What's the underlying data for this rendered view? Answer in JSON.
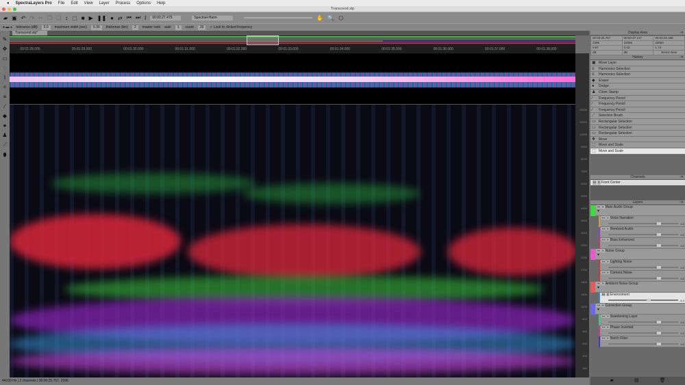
{
  "menubar": {
    "app": "SpectraLayers Pro",
    "items": [
      "File",
      "Edit",
      "View",
      "Layer",
      "Process",
      "Options",
      "Help"
    ]
  },
  "window": {
    "title": "Transcend.slp"
  },
  "options": {
    "tolerance_label": "tolerance (dB)",
    "tolerance": "6.0",
    "max_width_label": "maximum width (sec)",
    "max_width": "0.30",
    "thickness_label": "thickness (bin)",
    "thickness": "2",
    "master_rank_label": "master rank",
    "auto_label": "auto",
    "auto": "1",
    "count_label": "count",
    "count": "20",
    "lock_label": "Lock to clicked frequency"
  },
  "toolbar": {
    "time": "00:00:27.475",
    "mode": "Spectral+Harm"
  },
  "doc_tab": "Transcend.slp*",
  "ruler": [
    "00:01:28.000",
    "00:01:29.000",
    "00:01:30.000",
    "00:01:31.000",
    "00:01:32.000",
    "00:01:33.000",
    "00:01:34.000",
    "00:01:35.000",
    "00:01:36.000",
    "00:01:37.000",
    "00:01:38.000"
  ],
  "freq_axis": [
    "15000",
    "13000",
    "11000",
    "9000",
    "8000",
    "7000",
    "6000",
    "5000",
    "4000",
    "3500",
    "3000",
    "2500",
    "2000",
    "1700",
    "1400",
    "1200",
    "1000",
    "800",
    "600",
    "500",
    "400",
    "300"
  ],
  "status": "44100 Hz | 2 channels | 00:00:25.757, 2396",
  "display_area": {
    "title": "Display Area",
    "cells": [
      "00:00:25.757",
      "00:00:27.137",
      "00:00:28.498",
      "2396",
      "22050",
      "22050",
      "0.87",
      "0.43",
      "1.73",
      "dB",
      "dB",
      ""
    ],
    "reset": "Reset View"
  },
  "history": {
    "title": "History",
    "items": [
      {
        "label": "Move Layer",
        "icon": "move-layer"
      },
      {
        "label": "Harmonics Selection",
        "icon": "harmonics"
      },
      {
        "label": "Harmonics Selection",
        "icon": "harmonics"
      },
      {
        "label": "Eraser",
        "icon": "eraser"
      },
      {
        "label": "Dodge",
        "icon": "dodge"
      },
      {
        "label": "Clone Stamp",
        "icon": "stamp"
      },
      {
        "label": "Frequency Pencil",
        "icon": "pencil"
      },
      {
        "label": "Frequency Pencil",
        "icon": "pencil"
      },
      {
        "label": "Frequency Pencil",
        "icon": "pencil"
      },
      {
        "label": "Selection Brush",
        "icon": "brush"
      },
      {
        "label": "Rectangular Selection",
        "icon": "rect"
      },
      {
        "label": "Rectangular Selection",
        "icon": "rect"
      },
      {
        "label": "Rectangular Selection",
        "icon": "rect"
      },
      {
        "label": "Move",
        "icon": "move"
      },
      {
        "label": "Move and Scale",
        "icon": "scale"
      },
      {
        "label": "Move and Scale",
        "icon": "scale"
      }
    ]
  },
  "channels": {
    "title": "Channels",
    "items": [
      "Front Center"
    ]
  },
  "layers": {
    "title": "Layers",
    "groups": [
      {
        "name": "Main Audio Group",
        "color": "#3ddc3d",
        "layers": [
          {
            "name": "Voice Narration",
            "color": "#c9a23a",
            "value": "0.0"
          },
          {
            "name": "Remixed Audio",
            "color": "#9a3ac9",
            "value": "0.0"
          },
          {
            "name": "Bass Enhanced",
            "color": "#c93a6a",
            "value": "0.0"
          }
        ]
      },
      {
        "name": "Noise Group",
        "color": "#e85ad0",
        "layers": [
          {
            "name": "Lighting Noise",
            "color": "#c93a3a",
            "value": "0.0"
          },
          {
            "name": "Camera Noise",
            "color": "#c93a3a",
            "value": "0.0"
          }
        ]
      },
      {
        "name": "Ambient Noise Group",
        "color": "#e85a5a",
        "layers": [
          {
            "name": "Environment",
            "color": "#3a8ac9",
            "value": "-4.4",
            "selected": true
          }
        ]
      },
      {
        "name": "Correction Group",
        "color": "#6a6ae8",
        "layers": [
          {
            "name": "Sweetening Layer",
            "color": "#3ac98a",
            "value": "0.0"
          },
          {
            "name": "Phase Inverted",
            "color": "#c93a8a",
            "value": "0.0"
          },
          {
            "name": "Notch Filter",
            "color": "#3a3ac9",
            "value": "0.0"
          }
        ]
      }
    ]
  }
}
